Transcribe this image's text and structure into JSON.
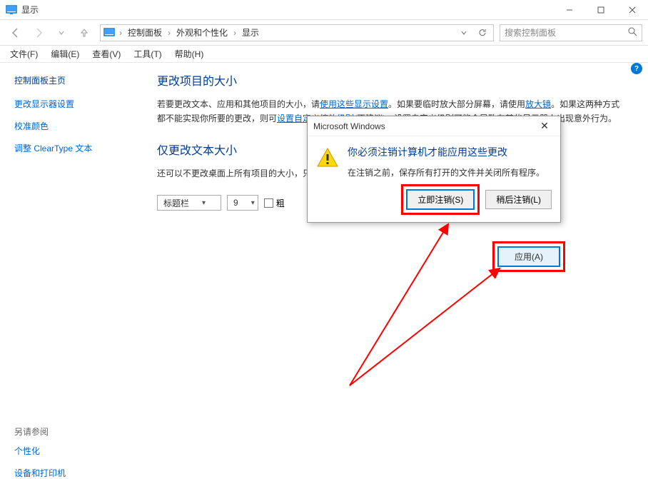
{
  "window": {
    "title": "显示",
    "search_placeholder": "搜索控制面板"
  },
  "breadcrumb": {
    "items": [
      "控制面板",
      "外观和个性化",
      "显示"
    ]
  },
  "menu": {
    "items": [
      "文件(F)",
      "编辑(E)",
      "查看(V)",
      "工具(T)",
      "帮助(H)"
    ]
  },
  "sidebar": {
    "home": "控制面板主页",
    "links": [
      "更改显示器设置",
      "校准颜色",
      "调整 ClearType 文本"
    ],
    "see_also_label": "另请参阅",
    "see_also": [
      "个性化",
      "设备和打印机"
    ]
  },
  "main": {
    "heading1": "更改项目的大小",
    "para_parts": {
      "p1": "若要更改文本、应用和其他项目的大小，请",
      "link1": "使用这些显示设置",
      "p2": "。如果要临时放大部分屏幕，请使用",
      "link2": "放大镜",
      "p3": "。如果这两种方式都不能实现你所要的更改，则可",
      "link3": "设置自定义缩放级别",
      "p4": "(不建议)。设置自定义级别可能会导致在某些显示器上出现意外行为。"
    },
    "heading2": "仅更改文本大小",
    "para2": "还可以不更改桌面上所有项目的大小，只",
    "select_item": "标题栏",
    "select_size": "9",
    "checkbox_label": "粗",
    "apply_label": "应用(A)"
  },
  "dialog": {
    "title": "Microsoft Windows",
    "heading": "你必须注销计算机才能应用这些更改",
    "text": "在注销之前，保存所有打开的文件并关闭所有程序。",
    "btn_primary": "立即注销(S)",
    "btn_secondary": "稍后注销(L)"
  }
}
